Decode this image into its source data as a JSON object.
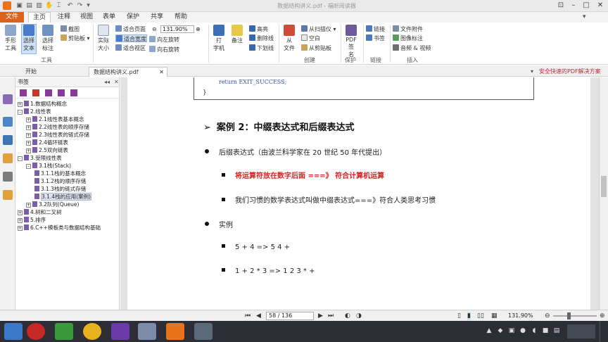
{
  "window": {
    "title": "数据结构讲义.pdf - 福昕阅读器"
  },
  "ribbon_tabs": [
    "文件",
    "主页",
    "注释",
    "视图",
    "表单",
    "保护",
    "共享",
    "帮助"
  ],
  "search": {
    "placeholder": "查找"
  },
  "ribbon": {
    "hand_tool": "手形\n工具",
    "select_text": "选择\n文本",
    "select_annot": "选择\n标注",
    "snapshot": "截图",
    "clipboard": "剪贴板",
    "actual_size": "实际\n大小",
    "fit_page": "适合页面",
    "fit_width": "适合宽度",
    "fit_visible": "适合视区",
    "zoom_value": "131.90%",
    "rotate_left": "向左旋转",
    "rotate_right": "向右旋转",
    "typewriter": "打\n字机",
    "note": "备注",
    "highlight": "高亮",
    "strikeout": "删除线",
    "underline": "下划线",
    "from_file": "从\n文件",
    "from_scanner": "从扫描仪",
    "blank": "空白",
    "from_clipboard": "从剪贴板",
    "pdf_sign": "PDF签\n名",
    "link": "链接",
    "bookmark": "书签",
    "file_attach": "文件附件",
    "image_annot": "图像标注",
    "audio_video": "音频 & 视频",
    "groups": {
      "tools": "工具",
      "create": "创建",
      "protect": "保护",
      "links": "链接",
      "insert": "插入"
    }
  },
  "doc_tabs": [
    "开始",
    "数据结构讲义.pdf"
  ],
  "ad_banner": "安全快速的PDF解决方案",
  "bookmarks_title": "书签",
  "bookmarks": [
    {
      "label": "1.数据结构概念",
      "level": 0,
      "exp": "+"
    },
    {
      "label": "2.线性表",
      "level": 0,
      "exp": "-"
    },
    {
      "label": "2.1线性表基本概念",
      "level": 1,
      "exp": "+"
    },
    {
      "label": "2.2线性表的顺序存储",
      "level": 1,
      "exp": "+"
    },
    {
      "label": "2.3线性表的链式存储",
      "level": 1,
      "exp": "+"
    },
    {
      "label": "2.4循环链表",
      "level": 1,
      "exp": "+"
    },
    {
      "label": "2.5双向链表",
      "level": 1,
      "exp": "+"
    },
    {
      "label": "3.受限线性表",
      "level": 0,
      "exp": "-"
    },
    {
      "label": "3.1栈(Stack)",
      "level": 1,
      "exp": "-"
    },
    {
      "label": "3.1.1栈的基本概念",
      "level": 2,
      "exp": ""
    },
    {
      "label": "3.1.2栈的顺序存储",
      "level": 2,
      "exp": ""
    },
    {
      "label": "3.1.3栈的链式存储",
      "level": 2,
      "exp": ""
    },
    {
      "label": "3.1.4栈的应用(案例)",
      "level": 2,
      "exp": "",
      "selected": true
    },
    {
      "label": "3.2队列(Queue)",
      "level": 1,
      "exp": "+"
    },
    {
      "label": "4.树和二叉树",
      "level": 0,
      "exp": "+"
    },
    {
      "label": "5.排序",
      "level": 0,
      "exp": "+"
    },
    {
      "label": "6.C++模板类与数据结构基础",
      "level": 0,
      "exp": "+"
    }
  ],
  "document": {
    "code_line": "return EXIT_SUCCESS;",
    "code_brace": "}",
    "heading_arrow": "➢",
    "heading": "案例 2：中缀表达式和后缀表达式",
    "bullet1": "后缀表达式（由波兰科学家在 20 世纪 50 年代提出）",
    "sub1": "将运算符放在数字后面 ===》 符合计算机运算",
    "sub2": "我们习惯的数学表达式叫做中缀表达式===》符合人类思考习惯",
    "bullet2": "实例",
    "ex1": "5 + 4 => 5 4 +",
    "ex2": "1 + 2 * 3 => 1 2 3 * +"
  },
  "status": {
    "page": "58 / 136",
    "zoom": "131.90%"
  }
}
